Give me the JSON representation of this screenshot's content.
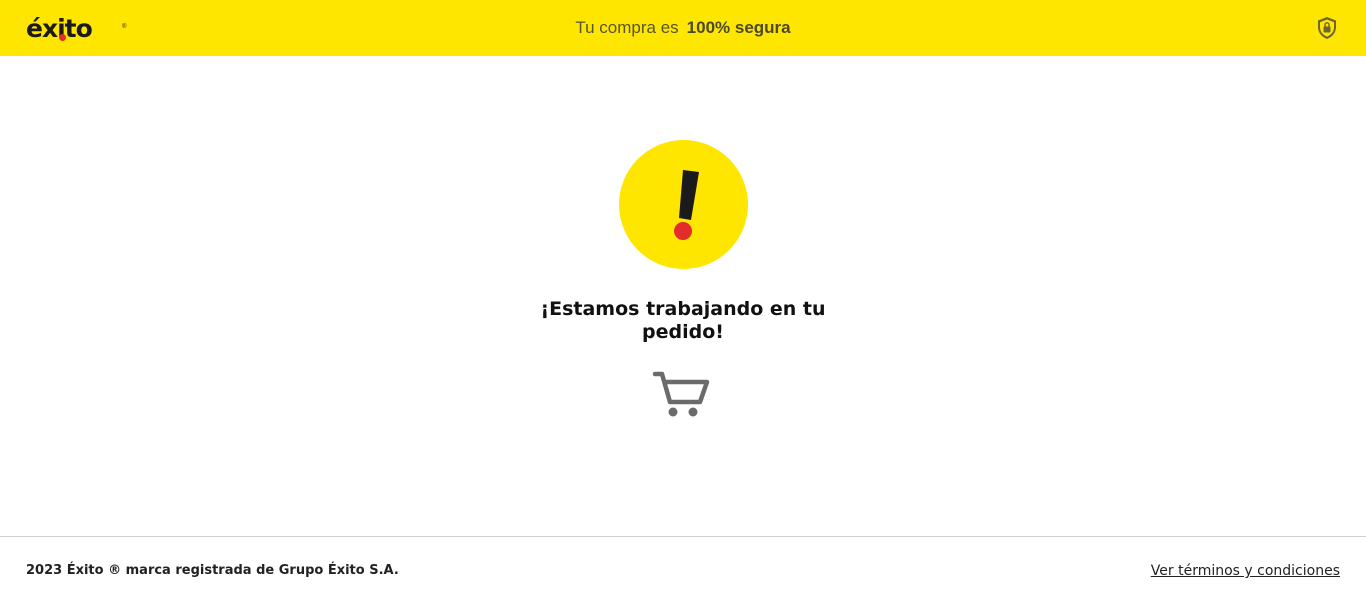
{
  "header": {
    "logo_text": "éxito",
    "logo_reg": "®",
    "secure_prefix": "Tu compra es",
    "secure_bold": "100% segura",
    "shield_icon": "shield-lock-icon"
  },
  "main": {
    "alert_icon": "exclamation-icon",
    "message_line1": "¡Estamos trabajando en tu",
    "message_line2": "pedido!",
    "cart_icon": "shopping-cart-icon"
  },
  "footer": {
    "copyright": "2023 Éxito ® marca registrada de Grupo Éxito S.A.",
    "terms_link": "Ver términos y condiciones"
  },
  "colors": {
    "brand_yellow": "#ffe600",
    "accent_red": "#e52c2c",
    "text_dark": "#111111",
    "icon_gray": "#6b6b6b"
  }
}
